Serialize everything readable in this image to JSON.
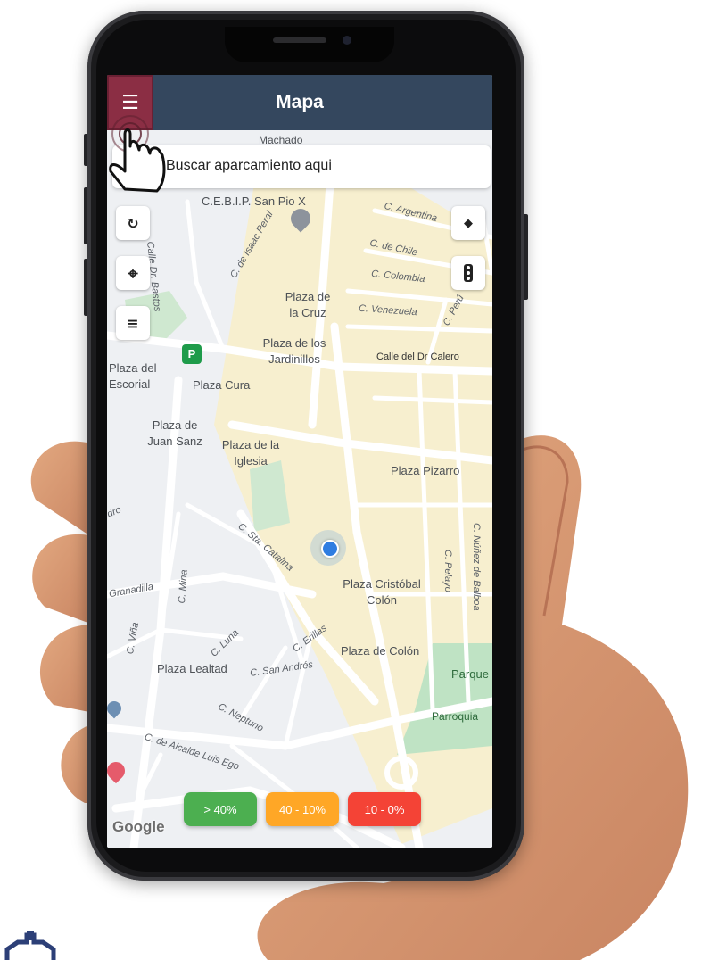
{
  "app": {
    "title": "Mapa",
    "menu_icon": "hamburger-menu-icon"
  },
  "search": {
    "icon": "search-icon",
    "placeholder": "Buscar aparcamiento aqui"
  },
  "map_controls": {
    "left": [
      {
        "name": "refresh",
        "icon": "refresh-icon",
        "glyph": "↻"
      },
      {
        "name": "locate",
        "icon": "crosshair-icon",
        "glyph": "⌖"
      },
      {
        "name": "filter",
        "icon": "filter-icon",
        "glyph": "≡"
      }
    ],
    "right": [
      {
        "name": "layers",
        "icon": "layers-icon",
        "glyph": "◆"
      },
      {
        "name": "traffic",
        "icon": "traffic-light-icon",
        "glyph": "🚦"
      }
    ]
  },
  "map": {
    "places": [
      "Machado",
      "C.E.B.I.P. San Pio X",
      "Plaza de la Cruz",
      "Plaza de los Jardinillos",
      "Plaza del Escorial",
      "Plaza Cura",
      "Plaza de Juan Sanz",
      "Plaza de la Iglesia",
      "Plaza Pizarro",
      "Plaza Cristóbal Colón",
      "Plaza de Colón",
      "Plaza Lealtad",
      "Parque",
      "Parroquia"
    ],
    "streets": [
      "C. Argentina",
      "C. de Chile",
      "C. Colombia",
      "C. Venezuela",
      "C. Perú",
      "Calle del Dr Calero",
      "Calle Dr. Bastos",
      "C. de Isaac Peral",
      "C. Sta. Catalina",
      "C. Mina",
      "C. Núñez de Balboa",
      "C. Pelayo",
      "Granadilla",
      "C. Viña",
      "C. Luna",
      "C. Erillas",
      "C. San Andrés",
      "C. Neptuno",
      "C. de Alcalde Luis Ego",
      "dro"
    ],
    "parking_marker": "P",
    "attribution": "Google"
  },
  "legend": [
    {
      "label": "> 40%",
      "color": "#4caf50"
    },
    {
      "label": "40 - 10%",
      "color": "#ffa726"
    },
    {
      "label": "10 - 0%",
      "color": "#f44336"
    }
  ],
  "colors": {
    "header": "#34475e",
    "menu_button": "#8b2e44",
    "location_dot": "#2f7de1"
  }
}
